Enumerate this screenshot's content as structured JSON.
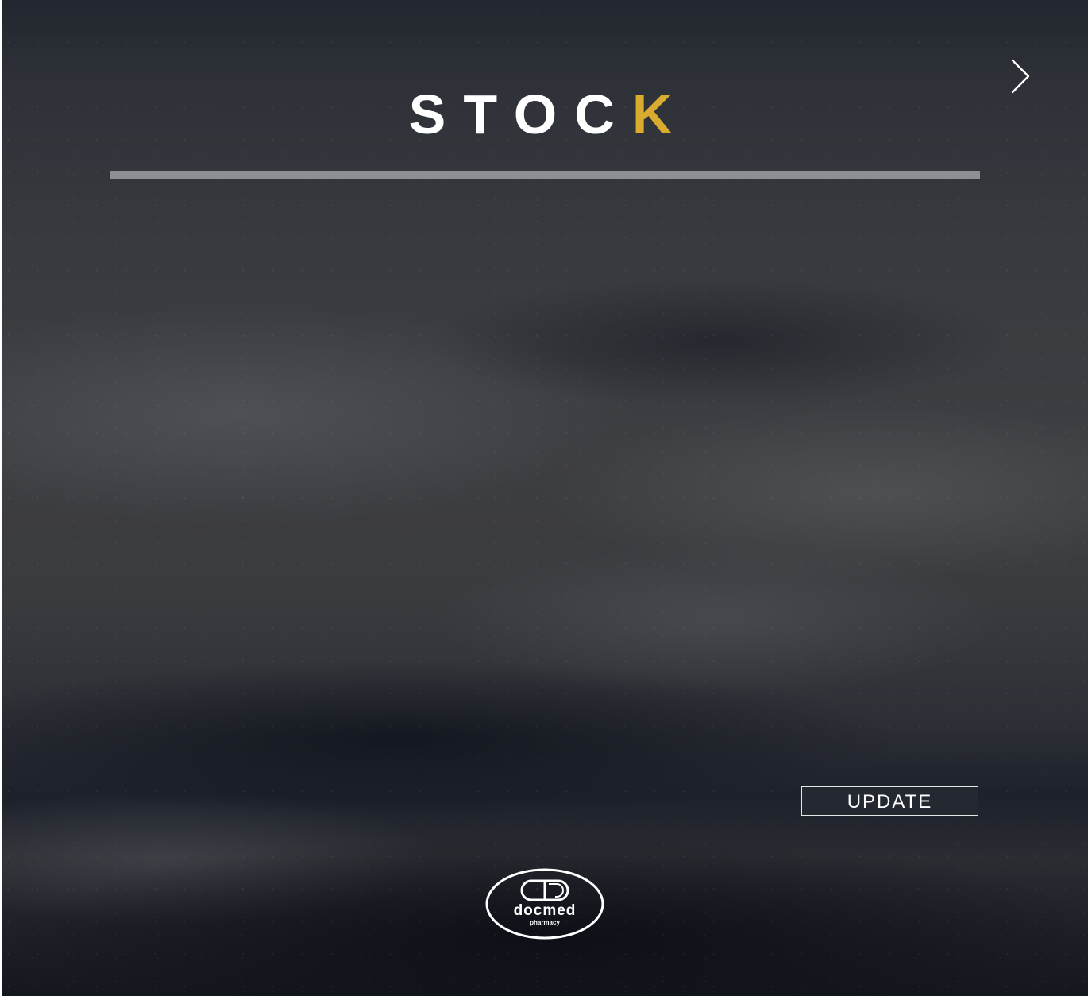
{
  "header": {
    "title_main": "STOC",
    "title_accent": "K",
    "accent_color": "#d9ab2e"
  },
  "navigation": {
    "next_icon": "chevron-right-icon"
  },
  "actions": {
    "update_label": "UPDATE"
  },
  "brand": {
    "name": "docmed",
    "tagline": "pharmacy",
    "logo_icon": "capsule-icon"
  }
}
